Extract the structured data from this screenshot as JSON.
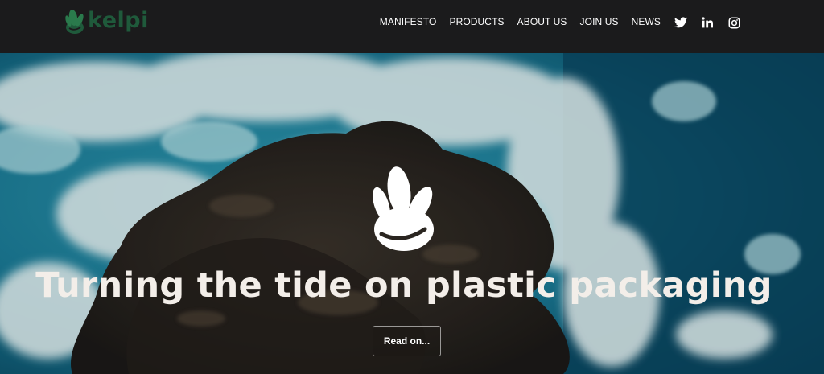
{
  "brand": {
    "name": "kelpi",
    "logo_icon": "kelp-icon",
    "logo_color": "#1f5a3b"
  },
  "nav": {
    "items": [
      {
        "label": "MANIFESTO"
      },
      {
        "label": "PRODUCTS"
      },
      {
        "label": "ABOUT US"
      },
      {
        "label": "JOIN US"
      },
      {
        "label": "NEWS"
      }
    ],
    "social": [
      "twitter-icon",
      "linkedin-icon",
      "instagram-icon"
    ]
  },
  "hero": {
    "headline": "Turning the tide on plastic packaging",
    "cta_label": "Read on...",
    "mark_icon": "kelp-icon",
    "background": "aerial-ocean-rock-image"
  },
  "colors": {
    "header_bg": "#1b1b1c",
    "ocean": "#0b4b63",
    "foam": "#d8f0f2",
    "rock": "#2b2622",
    "text": "#f3eee9"
  }
}
